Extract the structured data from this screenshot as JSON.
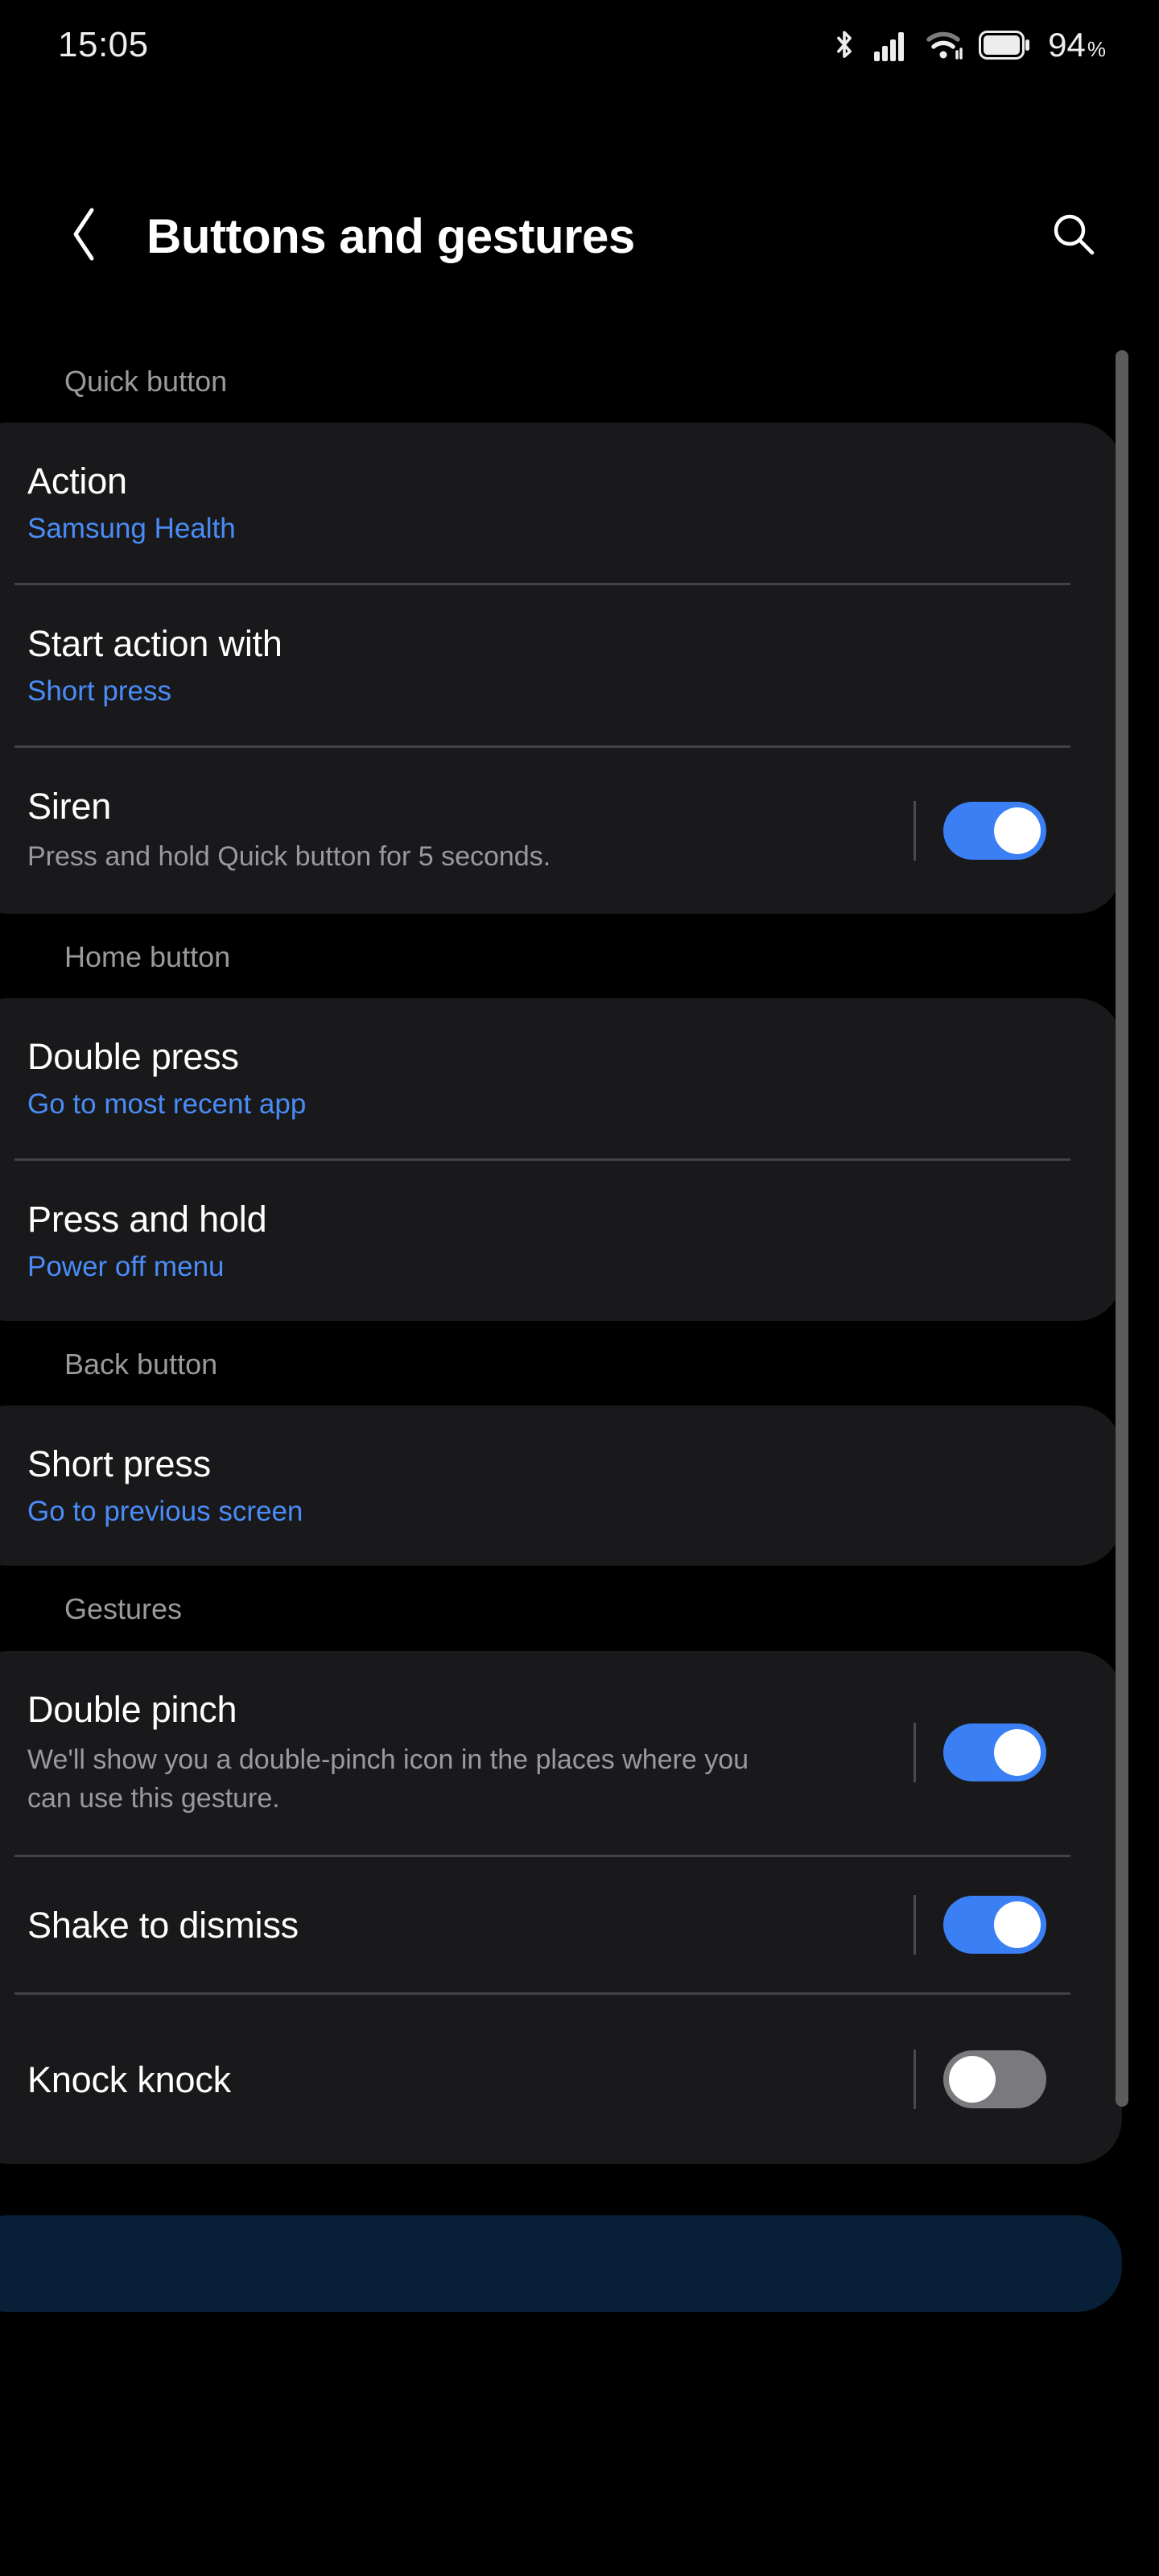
{
  "status_bar": {
    "time": "15:05",
    "battery_percent": "94",
    "percent_symbol": "%",
    "icons": [
      "bluetooth-icon",
      "cellular-signal-icon",
      "wifi-icon",
      "battery-icon"
    ]
  },
  "app_bar": {
    "back_icon": "chevron-left-icon",
    "title": "Buttons and gestures",
    "search_icon": "search-icon"
  },
  "colors": {
    "background": "#000000",
    "card": "#19191b",
    "accent_blue": "#4a8cf7",
    "toggle_on": "#3b7ff5",
    "toggle_off": "#7a7a7e",
    "secondary_text": "#9a9a9e",
    "divider": "#434347",
    "peek_card": "#072037"
  },
  "sections": [
    {
      "header": "Quick button",
      "rows": [
        {
          "title": "Action",
          "subtitle": "Samsung Health",
          "type": "value"
        },
        {
          "title": "Start action with",
          "subtitle": "Short press",
          "type": "value"
        },
        {
          "title": "Siren",
          "description": "Press and hold Quick button for 5 seconds.",
          "type": "toggle",
          "toggle_state": "on"
        }
      ]
    },
    {
      "header": "Home button",
      "rows": [
        {
          "title": "Double press",
          "subtitle": "Go to most recent app",
          "type": "value"
        },
        {
          "title": "Press and hold",
          "subtitle": "Power off menu",
          "type": "value"
        }
      ]
    },
    {
      "header": "Back button",
      "rows": [
        {
          "title": "Short press",
          "subtitle": "Go to previous screen",
          "type": "value"
        }
      ]
    },
    {
      "header": "Gestures",
      "rows": [
        {
          "title": "Double pinch",
          "description": "We'll show you a double-pinch icon in the places where you can use this gesture.",
          "type": "toggle",
          "toggle_state": "on"
        },
        {
          "title": "Shake to dismiss",
          "type": "toggle",
          "toggle_state": "on"
        },
        {
          "title": "Knock knock",
          "type": "toggle",
          "toggle_state": "off"
        }
      ]
    }
  ],
  "scrollbar": {
    "name": "vertical-scrollbar"
  }
}
